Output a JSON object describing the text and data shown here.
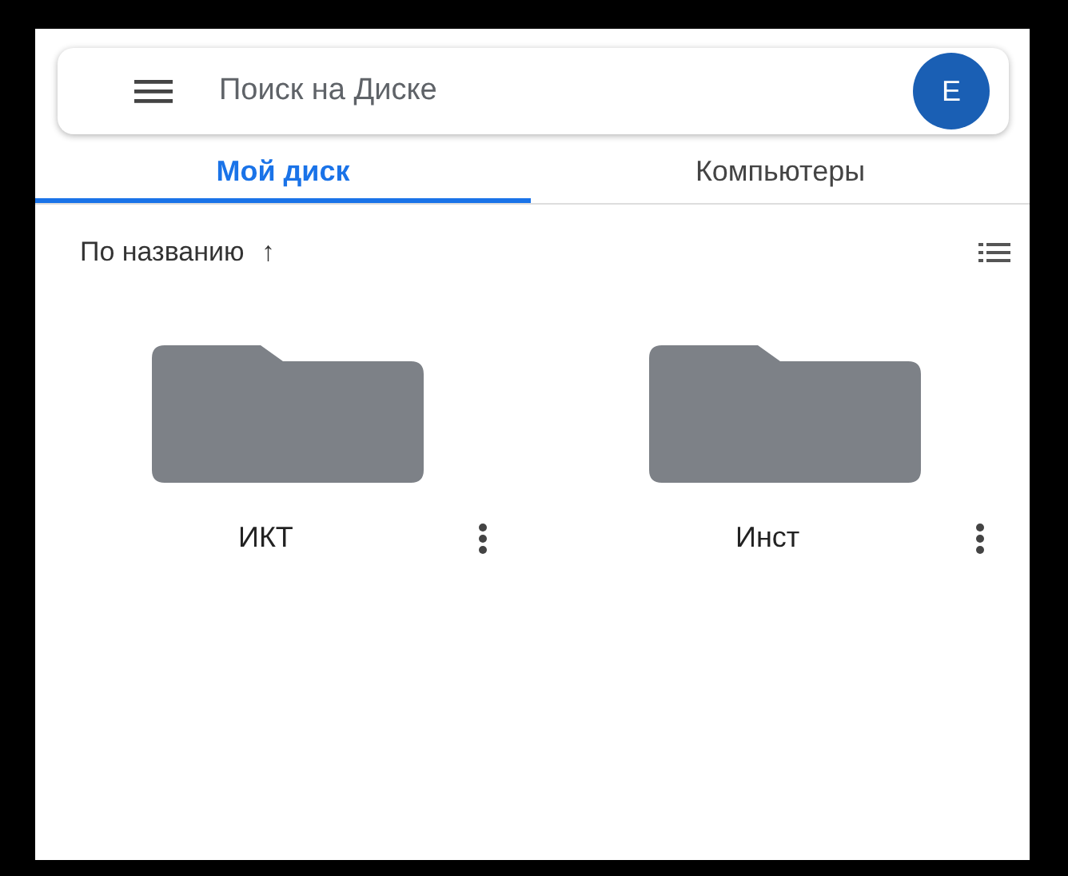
{
  "search": {
    "placeholder": "Поиск на Диске",
    "avatar": "E"
  },
  "tabs": [
    {
      "label": "Мой диск",
      "selected": true
    },
    {
      "label": "Компьютеры",
      "selected": false
    }
  ],
  "sort": {
    "label": "По названию",
    "arrow": "↑"
  },
  "folders": [
    {
      "name": "ИКТ"
    },
    {
      "name": "Инст"
    }
  ]
}
